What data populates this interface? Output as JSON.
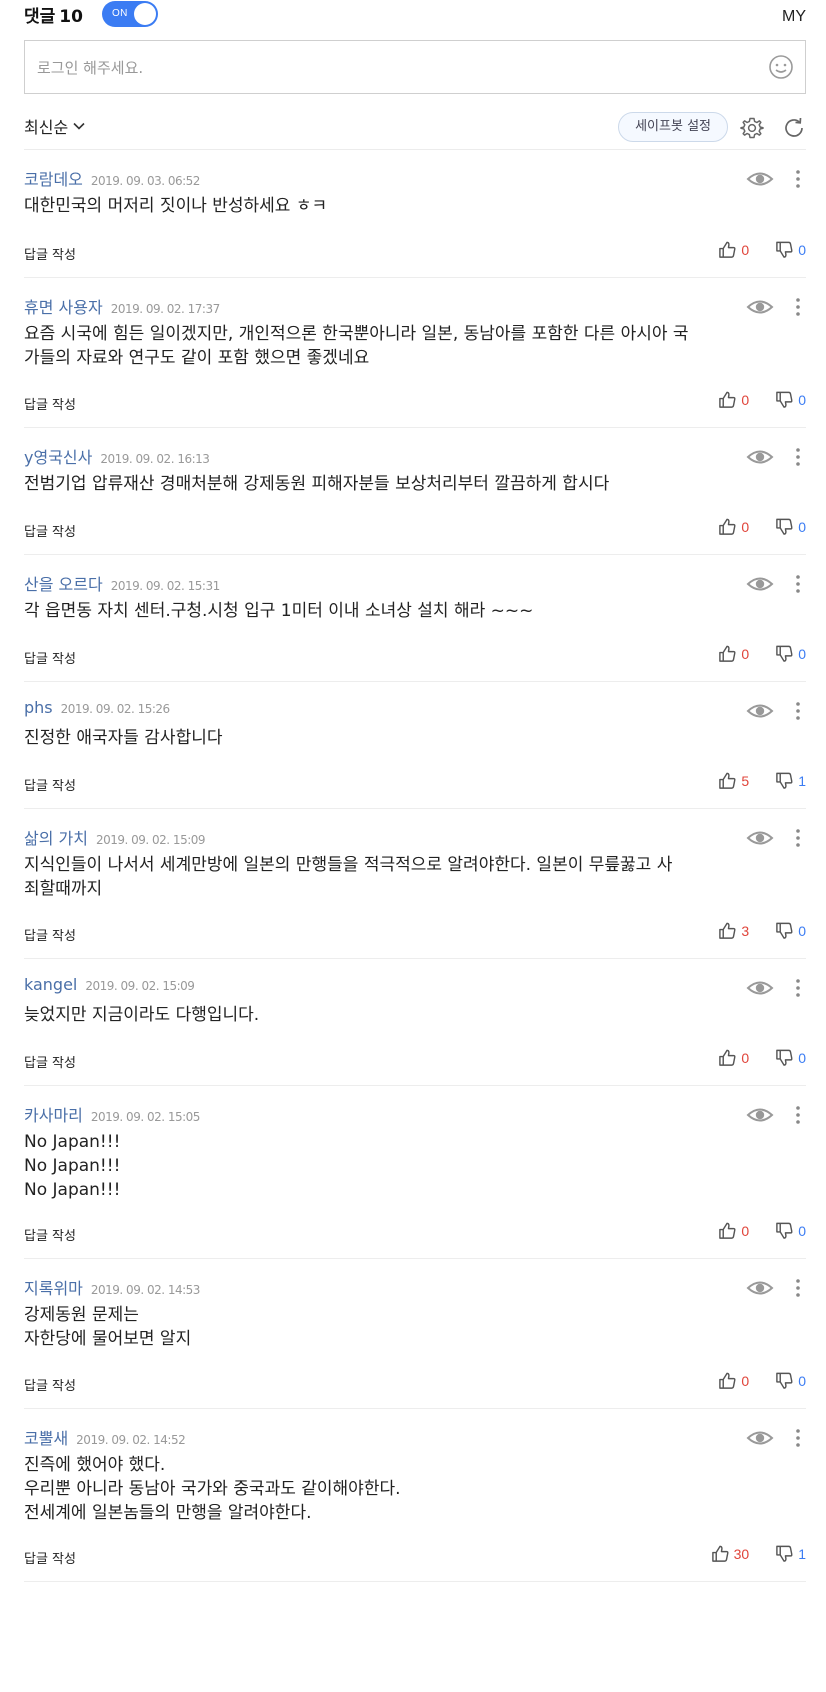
{
  "header": {
    "title": "댓글",
    "count": "10",
    "toggle_label": "ON",
    "my_label": "MY"
  },
  "login": {
    "placeholder": "로그인 해주세요."
  },
  "toolbar": {
    "sort_label": "최신순",
    "safebot_label": "세이프봇 설정"
  },
  "icons": {
    "smile": "smile-icon",
    "chevron": "chevron-down-icon",
    "gear": "gear-icon",
    "refresh": "refresh-icon",
    "eye": "eye-icon",
    "more": "more-vertical-icon",
    "like": "thumbs-up-icon",
    "dislike": "thumbs-down-icon"
  },
  "colors": {
    "accent": "#3b7cf3",
    "author": "#4a6fa8",
    "like": "#e0443a",
    "dislike": "#3b7cf3"
  },
  "comments": [
    {
      "author": "코람데오",
      "date": "2019. 09. 03. 06:52",
      "lines": [
        "대한민국의 머저리 짓이나 반성하세요 ㅎㅋ"
      ],
      "reply_label": "답글 작성",
      "likes": "0",
      "dislikes": "0"
    },
    {
      "author": "휴면 사용자",
      "date": "2019. 09. 02. 17:37",
      "lines": [
        "요즘 시국에 힘든 일이겠지만, 개인적으론 한국뿐아니라 일본, 동남아를 포함한 다른 아시아 국",
        "가들의 자료와 연구도 같이 포함 했으면 좋겠네요"
      ],
      "reply_label": "답글 작성",
      "likes": "0",
      "dislikes": "0"
    },
    {
      "author": "y영국신사",
      "date": "2019. 09. 02. 16:13",
      "lines": [
        "전범기업 압류재산 경매처분해 강제동원 피해자분들 보상처리부터 깔끔하게 합시다"
      ],
      "reply_label": "답글 작성",
      "likes": "0",
      "dislikes": "0"
    },
    {
      "author": "산을 오르다",
      "date": "2019. 09. 02. 15:31",
      "lines": [
        "각 읍면동 자치 센터.구청.시청 입구 1미터 이내 소녀상 설치 해라 ~~~"
      ],
      "reply_label": "답글 작성",
      "likes": "0",
      "dislikes": "0"
    },
    {
      "author": "phs",
      "date": "2019. 09. 02. 15:26",
      "lines": [
        "진정한 애국자들 감사합니다"
      ],
      "reply_label": "답글 작성",
      "likes": "5",
      "dislikes": "1"
    },
    {
      "author": "삶의 가치",
      "date": "2019. 09. 02. 15:09",
      "lines": [
        "지식인들이 나서서 세계만방에 일본의 만행들을 적극적으로 알려야한다. 일본이 무릎꿇고 사",
        "죄할때까지"
      ],
      "reply_label": "답글 작성",
      "likes": "3",
      "dislikes": "0"
    },
    {
      "author": "kangel",
      "date": "2019. 09. 02. 15:09",
      "lines": [
        "늦었지만 지금이라도 다행입니다."
      ],
      "reply_label": "답글 작성",
      "likes": "0",
      "dislikes": "0"
    },
    {
      "author": "카사마리",
      "date": "2019. 09. 02. 15:05",
      "lines": [
        "No Japan!!!",
        "No Japan!!!",
        "No Japan!!!"
      ],
      "reply_label": "답글 작성",
      "likes": "0",
      "dislikes": "0"
    },
    {
      "author": "지록위마",
      "date": "2019. 09. 02. 14:53",
      "lines": [
        "강제동원 문제는",
        "자한당에 물어보면 알지"
      ],
      "reply_label": "답글 작성",
      "likes": "0",
      "dislikes": "0"
    },
    {
      "author": "코뿔새",
      "date": "2019. 09. 02. 14:52",
      "lines": [
        "진즉에 했어야 했다.",
        "우리뿐 아니라 동남아 국가와 중국과도 같이해야한다.",
        "전세계에 일본놈들의 만행을 알려야한다."
      ],
      "reply_label": "답글 작성",
      "likes": "30",
      "dislikes": "1"
    }
  ]
}
